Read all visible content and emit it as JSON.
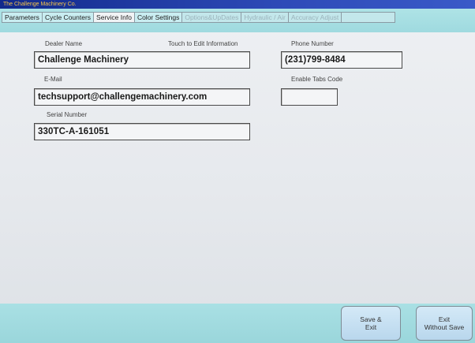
{
  "window": {
    "title": "The Challenge Machinery Co."
  },
  "tabs": [
    {
      "label": "Parameters",
      "state": "normal"
    },
    {
      "label": "Cycle Counters",
      "state": "normal"
    },
    {
      "label": "Service Info",
      "state": "active"
    },
    {
      "label": "Color Settings",
      "state": "normal"
    },
    {
      "label": "Options&UpDates",
      "state": "disabled"
    },
    {
      "label": "Hydraulic / Air",
      "state": "disabled"
    },
    {
      "label": "Accuracy Adjust",
      "state": "disabled"
    }
  ],
  "form": {
    "hint": "Touch to Edit Information",
    "dealer_name": {
      "label": "Dealer Name",
      "value": "Challenge Machinery"
    },
    "email": {
      "label": "E-Mail",
      "value": "techsupport@challengemachinery.com"
    },
    "serial_number": {
      "label": "Serial Number",
      "value": "330TC-A-161051"
    },
    "phone_number": {
      "label": "Phone Number",
      "value": "(231)799-8484"
    },
    "enable_tabs_code": {
      "label": "Enable Tabs Code",
      "value": ""
    }
  },
  "buttons": {
    "save_exit": {
      "line1": "Save &",
      "line2": "Exit"
    },
    "exit_without_save": {
      "line1": "Exit",
      "line2": "Without Save"
    }
  },
  "colors": {
    "title_bar": "#2e4bb8",
    "title_text": "#f7c548",
    "tab_strip": "#aee3e6",
    "panel": "#e6e9ed",
    "button": "#c6e0f2"
  }
}
